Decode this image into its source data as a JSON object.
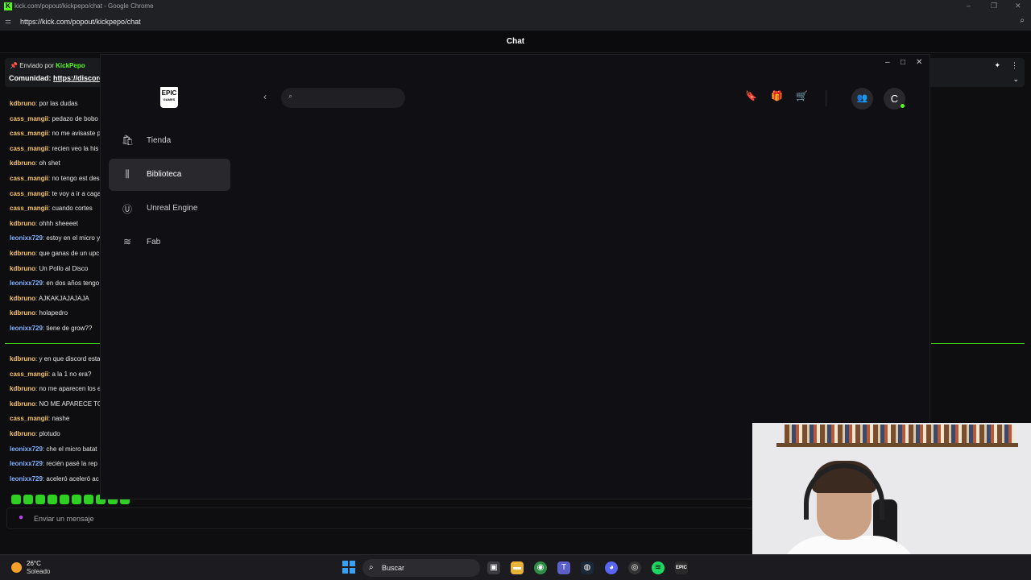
{
  "chrome": {
    "title": "kick.com/popout/kickpepo/chat - Google Chrome",
    "url": "https://kick.com/popout/kickpepo/chat",
    "favicon_letter": "K"
  },
  "chat": {
    "header": "Chat",
    "pinned": {
      "sent_by_label": "Enviado por",
      "sent_by_user": "KickPepo",
      "community_label": "Comunidad:",
      "community_link": "https://discord."
    },
    "messages_top": [
      {
        "user": "kdbruno",
        "text": "por las dudas",
        "color": "#f5c36b"
      },
      {
        "user": "cass_mangii",
        "text": "pedazo de bobo",
        "color": "#f5c36b"
      },
      {
        "user": "cass_mangii",
        "text": "no me avisaste p",
        "color": "#f5c36b"
      },
      {
        "user": "cass_mangii",
        "text": "recien veo la his",
        "color": "#f5c36b"
      },
      {
        "user": "kdbruno",
        "text": "oh shet",
        "color": "#f5c36b"
      },
      {
        "user": "cass_mangii",
        "text": "no tengo est des",
        "color": "#f5c36b"
      },
      {
        "user": "cass_mangii",
        "text": "te voy a ir a caga",
        "color": "#f5c36b"
      },
      {
        "user": "cass_mangii",
        "text": "cuando cortes",
        "color": "#f5c36b"
      },
      {
        "user": "kdbruno",
        "text": "ohhh sheeeet",
        "color": "#f5c36b"
      },
      {
        "user": "leonixx729",
        "text": "estoy en el micro y",
        "color": "#7fb2ff"
      },
      {
        "user": "kdbruno",
        "text": "que ganas de un upc",
        "color": "#f5c36b"
      },
      {
        "user": "kdbruno",
        "text": "Un Pollo al Disco",
        "color": "#f5c36b"
      },
      {
        "user": "leonixx729",
        "text": "en dos años tengo",
        "color": "#7fb2ff"
      },
      {
        "user": "kdbruno",
        "text": "AJKAKJAJAJAJA",
        "color": "#f5c36b"
      },
      {
        "user": "kdbruno",
        "text": "holapedro",
        "color": "#f5c36b"
      },
      {
        "user": "leonixx729",
        "text": "tiene de grow??",
        "color": "#7fb2ff"
      }
    ],
    "messages_bottom": [
      {
        "user": "kdbruno",
        "text": "y en que discord esta",
        "color": "#f5c36b"
      },
      {
        "user": "cass_mangii",
        "text": "a la 1 no era?",
        "color": "#f5c36b"
      },
      {
        "user": "kdbruno",
        "text": "no me aparecen los e",
        "color": "#f5c36b"
      },
      {
        "user": "kdbruno",
        "text": "NO ME APARECE TO",
        "color": "#f5c36b"
      },
      {
        "user": "cass_mangii",
        "text": "nashe",
        "color": "#f5c36b"
      },
      {
        "user": "kdbruno",
        "text": "plotudo",
        "color": "#f5c36b"
      },
      {
        "user": "leonixx729",
        "text": "che el micro batat",
        "color": "#7fb2ff"
      },
      {
        "user": "leonixx729",
        "text": "recién pasé la rep",
        "color": "#7fb2ff"
      },
      {
        "user": "leonixx729",
        "text": "aceleró aceleró ac",
        "color": "#7fb2ff"
      }
    ],
    "input_placeholder": "Enviar un mensaje",
    "accent": "#53fc18"
  },
  "epic": {
    "logo_text": "EPIC",
    "logo_sub": "GAMES",
    "nav": [
      {
        "label": "Tienda",
        "icon": "shopping-bag-icon",
        "active": false
      },
      {
        "label": "Biblioteca",
        "icon": "library-icon",
        "active": true
      },
      {
        "label": "Unreal Engine",
        "icon": "unreal-icon",
        "active": false
      },
      {
        "label": "Fab",
        "icon": "fab-icon",
        "active": false
      }
    ],
    "avatar_letter": "C"
  },
  "taskbar": {
    "temperature": "26°C",
    "condition": "Soleado",
    "search_label": "Buscar"
  }
}
